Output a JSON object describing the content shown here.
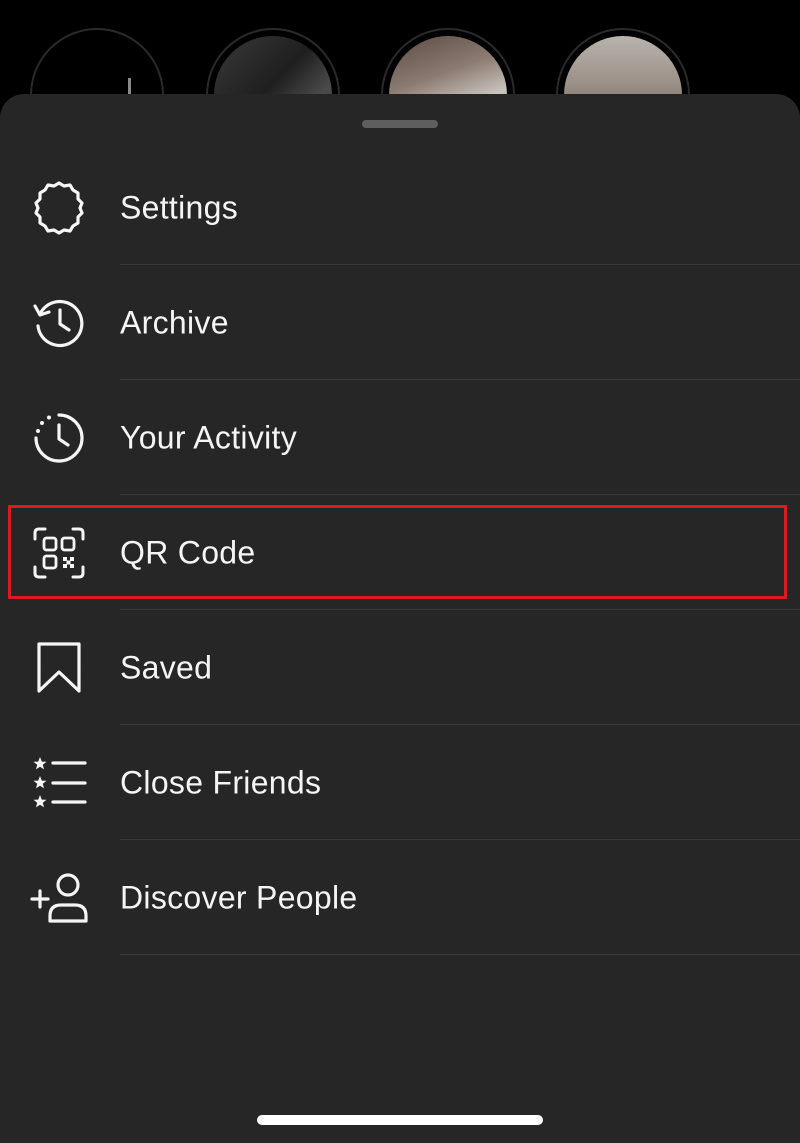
{
  "menu": {
    "items": [
      {
        "label": "Settings",
        "icon": "settings-gear-icon"
      },
      {
        "label": "Archive",
        "icon": "archive-clock-icon"
      },
      {
        "label": "Your Activity",
        "icon": "activity-clock-icon"
      },
      {
        "label": "QR Code",
        "icon": "qr-code-icon",
        "highlighted": true
      },
      {
        "label": "Saved",
        "icon": "bookmark-icon"
      },
      {
        "label": "Close Friends",
        "icon": "close-friends-list-icon"
      },
      {
        "label": "Discover People",
        "icon": "add-person-icon"
      }
    ]
  },
  "colors": {
    "sheet_background": "#262626",
    "text": "#f5f5f5",
    "highlight_box": "#d91c24",
    "divider": "#383838"
  }
}
